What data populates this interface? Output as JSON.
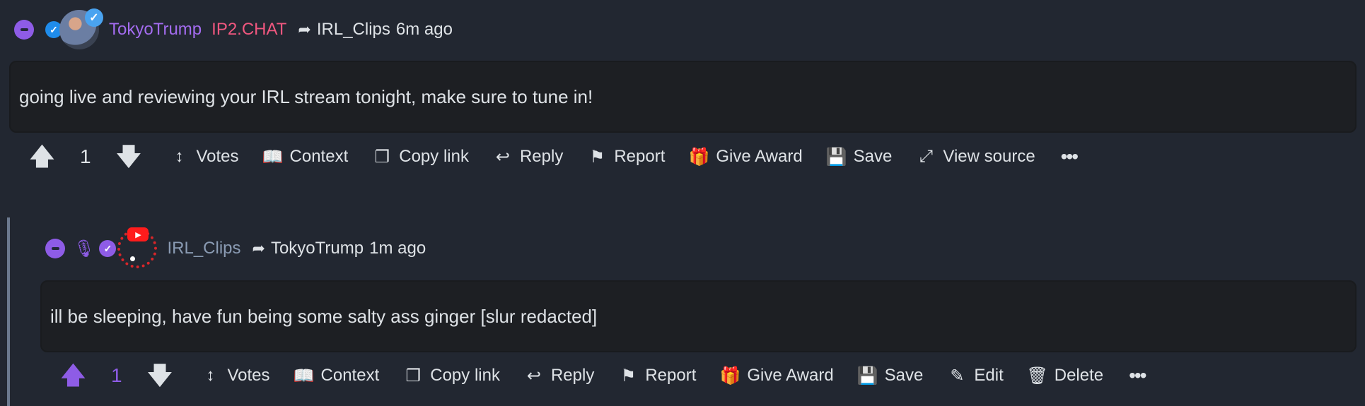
{
  "comments": [
    {
      "username": "TokyoTrump",
      "flair": "IP2.CHAT",
      "reply_to": "IRL_Clips",
      "time": "6m ago",
      "body": "going live and reviewing your IRL stream tonight, make sure to tune in!",
      "score": "1",
      "actions": [
        "Votes",
        "Context",
        "Copy link",
        "Reply",
        "Report",
        "Give Award",
        "Save",
        "View source"
      ]
    },
    {
      "username": "IRL_Clips",
      "reply_to": "TokyoTrump",
      "time": "1m ago",
      "body": "ill be sleeping, have fun being some salty ass ginger [slur redacted]",
      "score": "1",
      "actions": [
        "Votes",
        "Context",
        "Copy link",
        "Reply",
        "Report",
        "Give Award",
        "Save",
        "Edit",
        "Delete"
      ]
    }
  ],
  "colors": {
    "accent": "#8e5ce6",
    "flair": "#f0577f",
    "background": "#222731",
    "body_box": "#1d1f23"
  }
}
